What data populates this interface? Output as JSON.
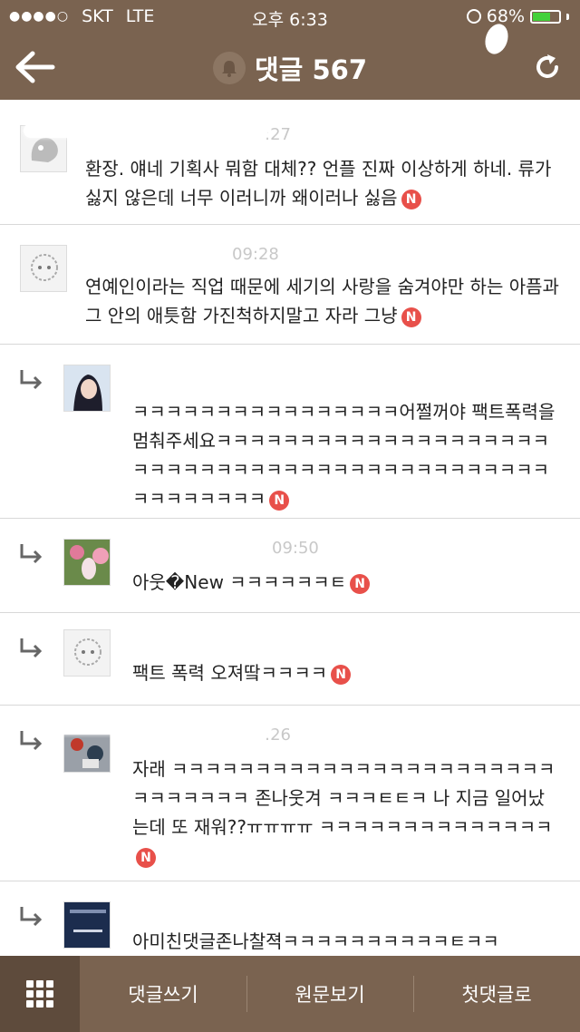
{
  "status_bar": {
    "carrier": "SKT",
    "network": "LTE",
    "time": "오후 6:33",
    "battery_percent": "68%",
    "battery_level": 0.68
  },
  "header": {
    "title": "댓글 567",
    "back_icon": "back-arrow-icon",
    "bell_icon": "bell-icon",
    "refresh_icon": "refresh-icon"
  },
  "comments": [
    {
      "time": ":27",
      "text": "환장. 얘네 기획사 뭐함 대체?? 언플 진짜 이상하게 하네. 류가 싫지 않은데 너무 이러니까 왜이러나 싫음",
      "badge": "N"
    },
    {
      "time": "09:28",
      "text": "연예인이라는 직업 때문에 세기의 사랑을 숨겨야만 하는 아픔과 그 안의 애틋함 가진척하지말고 자라 그냥",
      "badge": "N"
    },
    {
      "time": "",
      "text": "ㅋㅋㅋㅋㅋㅋㅋㅋㅋㅋㅋㅋㅋㅋㅋㅋ어쩔꺼야 팩트폭력을 멈춰주세요ㅋㅋㅋㅋㅋㅋㅋㅋㅋㅋㅋㅋㅋㅋㅋㅋㅋㅋㅋㅋㅋㅋㅋㅋㅋㅋㅋㅋㅋㅋㅋㅋㅋㅋㅋㅋㅋㅋㅋㅋㅋㅋㅋㅋㅋㅋㅋㅋㅋㅋㅋㅋㅋ",
      "badge": "N"
    },
    {
      "time": "09:50",
      "text": "아웃�New ㅋㅋㅋㅋㅋㅋㅌ",
      "badge": "N"
    },
    {
      "time": "",
      "text": "팩트 폭력 오져땈ㅋㅋㅋㅋ",
      "badge": "N"
    },
    {
      "time": ":26",
      "text": "자래 ㅋㅋㅋㅋㅋㅋㅋㅋㅋㅋㅋㅋㅋㅋㅋㅋㅋㅋㅋㅋㅋㅋㅋㅋㅋㅋㅋㅋㅋㅋ 존나웃겨 ㅋㅋㅋㅌㅌㅋ 나 지금 일어났는데 또 재워??ㅠㅠㅠㅠ ㅋㅋㅋㅋㅋㅋㅋㅋㅋㅋㅋㅋㅋㅋ",
      "badge": "N"
    },
    {
      "time": "",
      "text": "아미친댓글존나찰젹ㅋㅋㅋㅋㅋㅋㅋㅋㅋㅋㅌㅋㅋ",
      "badge": ""
    }
  ],
  "bottom_bar": {
    "menu_icon": "grid-menu-icon",
    "write_label": "댓글쓰기",
    "original_label": "원문보기",
    "first_label": "첫댓글로"
  }
}
